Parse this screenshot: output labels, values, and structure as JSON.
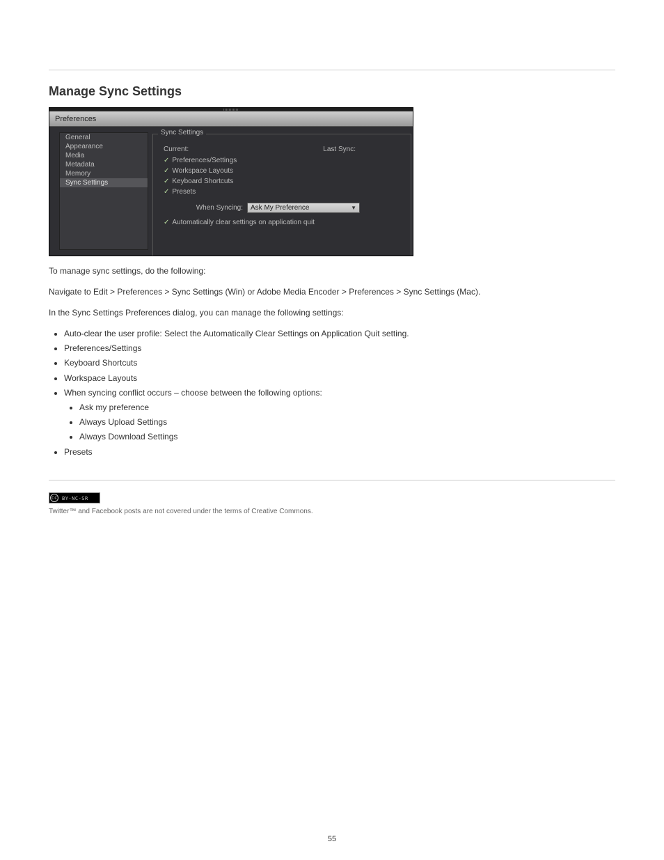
{
  "page_number": "55",
  "section": {
    "heading_mgr": "Manage Sync Settings",
    "para_mgr": "To manage sync settings, do the following:",
    "list_mgr_step": "Navigate to Edit > Preferences > Sync Settings (Win) or Adobe Media Encoder > Preferences > Sync Settings (Mac).",
    "para_options": "In the Sync Settings Preferences dialog, you can manage the following settings:",
    "opts": [
      "Auto-clear the user profile: Select the Automatically Clear Settings on Application Quit setting.",
      "Preferences/Settings",
      "Keyboard Shortcuts",
      "Workspace Layouts",
      "When syncing conflict occurs – choose between the following options:",
      "Presets"
    ],
    "conflict_opts": [
      "Ask my preference",
      "Always Upload Settings",
      "Always Download Settings"
    ],
    "cc_caption": "Twitter™ and Facebook posts are not covered under the terms of Creative Commons."
  },
  "dialog": {
    "title": "Preferences",
    "sidebar": [
      "General",
      "Appearance",
      "Media",
      "Metadata",
      "Memory",
      "Sync Settings"
    ],
    "sidebar_selected": 5,
    "legend": "Sync Settings",
    "current_label": "Current:",
    "lastsync_label": "Last Sync:",
    "checkboxes": [
      "Preferences/Settings",
      "Workspace Layouts",
      "Keyboard Shortcuts",
      "Presets"
    ],
    "when_syncing_label": "When Syncing:",
    "dropdown_value": "Ask My Preference",
    "autoclear": "Automatically clear settings on application quit"
  },
  "cc_badge_text": "BY-NC-SR"
}
